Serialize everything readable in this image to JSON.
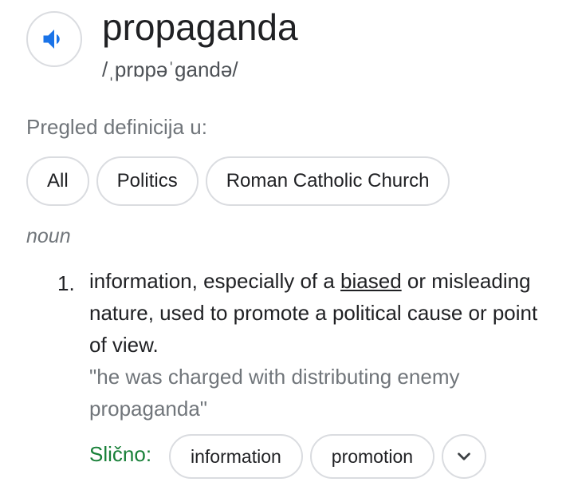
{
  "entry": {
    "word": "propaganda",
    "phonetic": "/ˌprɒpəˈɡandə/",
    "audio_icon": "speaker-icon"
  },
  "overview": {
    "label": "Pregled definicija u:",
    "chips": [
      "All",
      "Politics",
      "Roman Catholic Church"
    ]
  },
  "definition": {
    "part_of_speech": "noun",
    "number": "1.",
    "text_before_link": "information, especially of a ",
    "link_text": "biased",
    "text_after_link": " or misleading nature, used to promote a political cause or point of view.",
    "example": "\"he was charged with distributing enemy propaganda\"",
    "similar_label": "Slično:",
    "similar": [
      "information",
      "promotion"
    ],
    "expand_icon": "chevron-down-icon"
  },
  "colors": {
    "accent_blue": "#1a73e8",
    "similar_green": "#188038",
    "chip_border": "#dadce0"
  }
}
